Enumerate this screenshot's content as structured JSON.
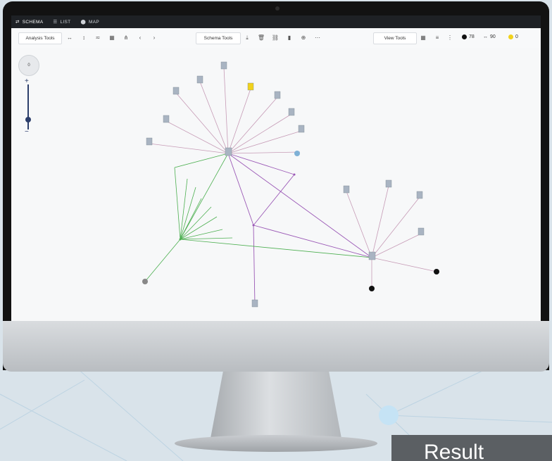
{
  "app": {
    "tabs": [
      {
        "label": "SCHEMA",
        "icon": "schema-icon"
      },
      {
        "label": "LIST",
        "icon": "list-icon"
      },
      {
        "label": "MAP",
        "icon": "map-pin-icon"
      }
    ]
  },
  "toolbar": {
    "analysis_tools": "Analysis Tools",
    "schema_tools": "Schema Tools",
    "view_tools": "View Tools",
    "counts": {
      "black": "78",
      "links": "90",
      "yellow": "0"
    }
  },
  "zoom": {
    "value": "0"
  },
  "colors": {
    "person_link": "#c69bb6",
    "group_link": "#4caf50",
    "accent_link": "#9b59b6"
  },
  "overlay": {
    "result_label": "Result"
  }
}
